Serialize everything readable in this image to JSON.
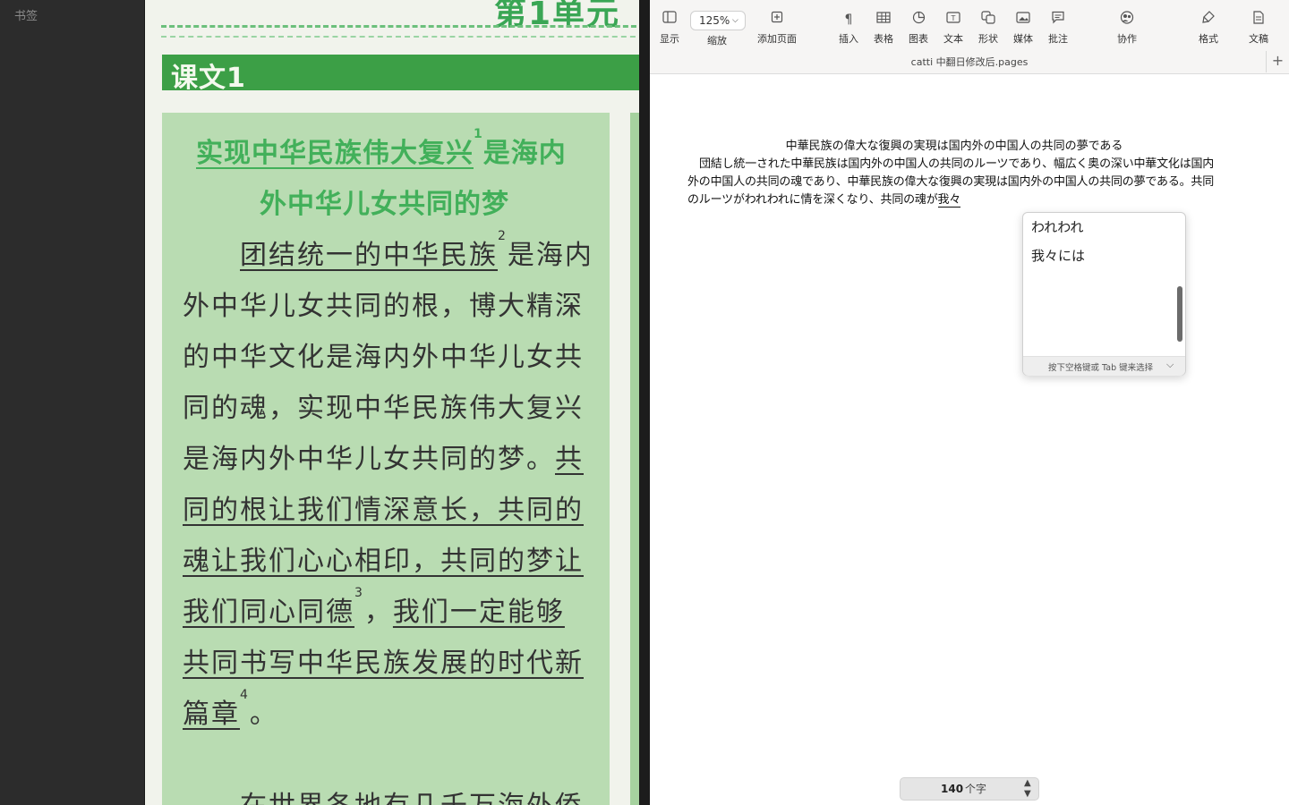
{
  "sidebar": {
    "title": "书签"
  },
  "scan": {
    "top_title_partial": "第1单元",
    "lesson_label": "课文1",
    "title_line1": "实现中华民族伟大复兴",
    "title_sup1": "1",
    "title_line1_tail": "是海内",
    "title_line2": "外中华儿女共同的梦",
    "lines": [
      {
        "u": "团结统一的中华民族",
        "sup": "2",
        "t": "是海内"
      },
      {
        "t": "外中华儿女共同的根，博大精深"
      },
      {
        "t": "的中华文化是海内外中华儿女共"
      },
      {
        "t": "同的魂，实现中华民族伟大复兴"
      },
      {
        "t": "是海内外中华儿女共同的梦。",
        "u2": "共"
      },
      {
        "u": "同的根让我们情深意长，共同的"
      },
      {
        "u": "魂让我们心心相印，共同的梦让"
      },
      {
        "u": "我们同心同德",
        "sup": "3",
        "t": "，",
        "u2": "我们一定能够"
      },
      {
        "u": "共同书写中华民族发展的时代新"
      },
      {
        "u": "篇章",
        "sup": "4",
        "t": "。"
      }
    ],
    "bottom_partial": "在世界各地有几千万海外侨"
  },
  "toolbar": {
    "display": {
      "label": "显示",
      "icon": "sidebar-icon"
    },
    "zoom_value": "125%",
    "zoom_label": "缩放",
    "add_page": {
      "label": "添加页面",
      "icon": "add-page-icon"
    },
    "insert": {
      "label": "插入",
      "icon": "pilcrow-icon"
    },
    "table": {
      "label": "表格",
      "icon": "table-icon"
    },
    "chart": {
      "label": "图表",
      "icon": "chart-icon"
    },
    "text": {
      "label": "文本",
      "icon": "textbox-icon"
    },
    "shape": {
      "label": "形状",
      "icon": "shape-icon"
    },
    "media": {
      "label": "媒体",
      "icon": "media-icon"
    },
    "comment": {
      "label": "批注",
      "icon": "comment-icon"
    },
    "collaborate": {
      "label": "协作",
      "icon": "collaborate-icon"
    },
    "format": {
      "label": "格式",
      "icon": "format-brush-icon"
    },
    "document": {
      "label": "文稿",
      "icon": "document-icon"
    }
  },
  "doc_title": "catti 中翻日修改后.pages",
  "document": {
    "heading": "中華民族の偉大な復興の実現は国内外の中国人の共同の夢である",
    "body": "団結し統一された中華民族は国内外の中国人の共同のルーツであり、幅広く奥の深い中華文化は国内外の中国人の共同の魂であり、中華民族の偉大な復興の実現は国内外の中国人の共同の夢である。共同のルーツがわれわれに情を深くなり、共同の魂が",
    "composing": "我々"
  },
  "ime": {
    "candidates": [
      "われわれ",
      "我々には"
    ],
    "hint": "按下空格键或 Tab 键来选择"
  },
  "wordcount": {
    "value": "140",
    "unit": "个字"
  }
}
